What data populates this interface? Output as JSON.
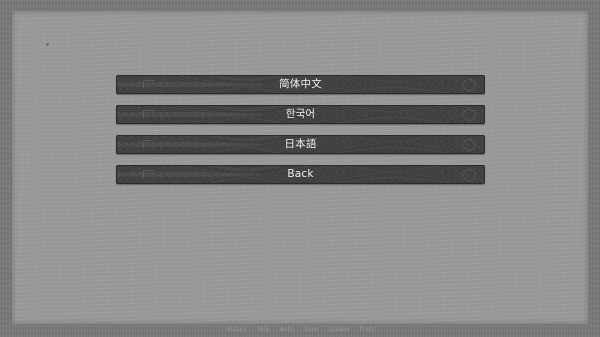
{
  "language_menu": {
    "options": [
      {
        "label": "简体中文"
      },
      {
        "label": "한국어"
      },
      {
        "label": "日本語"
      },
      {
        "label": "Back"
      }
    ]
  },
  "quick_menu": {
    "items": [
      "History",
      "Skip",
      "Auto",
      "Save",
      "Q.Save",
      "Prefs"
    ]
  },
  "colors": {
    "frame": "#7a7a7a",
    "panel": "#9a9a9a",
    "button": "#3d3d3d",
    "button_text": "#f2f2f2"
  }
}
